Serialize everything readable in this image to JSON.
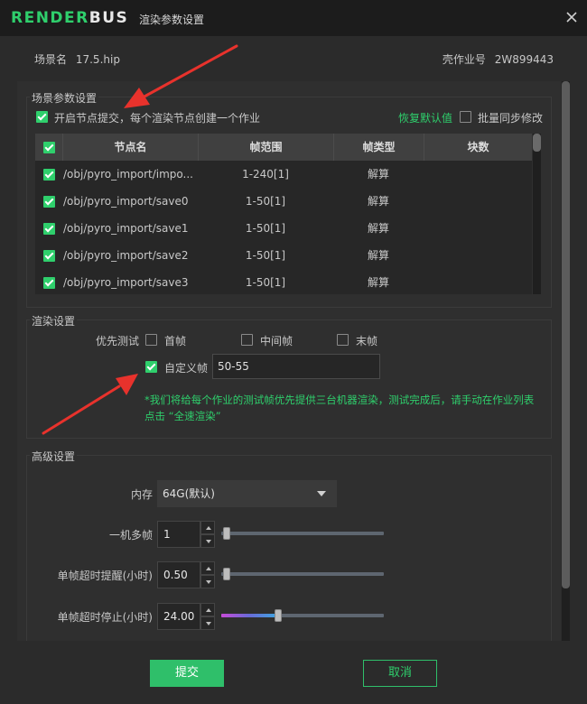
{
  "window": {
    "logo_render": "RENDER",
    "logo_bus": "BUS",
    "title": "渲染参数设置"
  },
  "info": {
    "scene_label": "场景名",
    "scene_value": "17.5.hip",
    "job_label": "壳作业号",
    "job_value": "2W899443"
  },
  "scene_params": {
    "title": "场景参数设置",
    "node_submit_label": "开启节点提交，每个渲染节点创建一个作业",
    "node_submit_checked": true,
    "restore_default": "恢复默认值",
    "batch_sync_label": "批量同步修改",
    "batch_sync_checked": false,
    "table": {
      "headers": [
        "节点名",
        "帧范围",
        "帧类型",
        "块数"
      ],
      "rows": [
        {
          "checked": true,
          "node": "/obj/pyro_import/impo...",
          "range": "1-240[1]",
          "type": "解算",
          "blocks": ""
        },
        {
          "checked": true,
          "node": "/obj/pyro_import/save0",
          "range": "1-50[1]",
          "type": "解算",
          "blocks": ""
        },
        {
          "checked": true,
          "node": "/obj/pyro_import/save1",
          "range": "1-50[1]",
          "type": "解算",
          "blocks": ""
        },
        {
          "checked": true,
          "node": "/obj/pyro_import/save2",
          "range": "1-50[1]",
          "type": "解算",
          "blocks": ""
        },
        {
          "checked": true,
          "node": "/obj/pyro_import/save3",
          "range": "1-50[1]",
          "type": "解算",
          "blocks": ""
        }
      ]
    }
  },
  "render_settings": {
    "title": "渲染设置",
    "priority_test_label": "优先测试",
    "first_frame": "首帧",
    "middle_frame": "中间帧",
    "last_frame": "末帧",
    "custom_frame_label": "自定义帧",
    "custom_frame_checked": true,
    "custom_frame_value": "50-55",
    "hint": "*我们将给每个作业的测试帧优先提供三台机器渲染，测试完成后，请手动在作业列表点击 “全速渲染”"
  },
  "advanced": {
    "title": "高级设置",
    "memory_label": "内存",
    "memory_value": "64G(默认)",
    "multi_frame_label": "一机多帧",
    "multi_frame_value": "1",
    "multi_frame_level": 0.0,
    "timeout_warn_label": "单帧超时提醒(小时)",
    "timeout_warn_value": "0.50",
    "timeout_warn_level": 0.0,
    "timeout_stop_label": "单帧超时停止(小时)",
    "timeout_stop_value": "24.00",
    "timeout_stop_level": 0.33
  },
  "footer": {
    "submit": "提交",
    "cancel": "取消"
  },
  "colors": {
    "accent": "#2fcf6c",
    "annotation_arrow": "#e8322c"
  }
}
